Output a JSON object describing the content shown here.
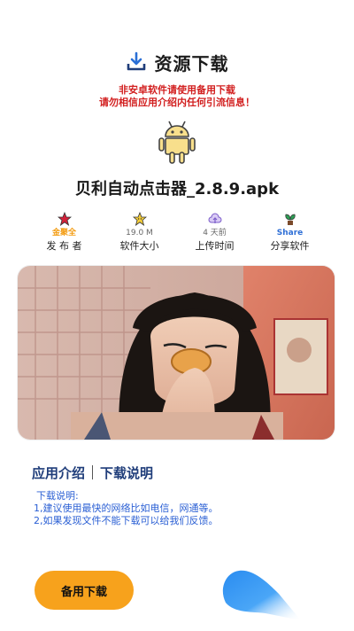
{
  "header": {
    "title": "资源下载",
    "icon": "download-icon"
  },
  "warning": {
    "line1": "非安卓软件请使用备用下载",
    "line2": "请勿相信应用介绍内任何引流信息！"
  },
  "app": {
    "name": "贝利自动点击器_2.8.9.apk",
    "icon": "android-icon"
  },
  "stats": [
    {
      "value": "金聚全",
      "label": "发 布 者",
      "icon": "star-badge-icon"
    },
    {
      "value": "19.0 M",
      "label": "软件大小",
      "icon": "smile-star-icon"
    },
    {
      "value": "4 天前",
      "label": "上传时间",
      "icon": "upload-cloud-icon"
    },
    {
      "value": "Share",
      "label": "分享软件",
      "icon": "share-plant-icon"
    }
  ],
  "tabs": {
    "intro": "应用介绍",
    "download": "下载说明"
  },
  "description": {
    "heading": "下载说明:",
    "line1": "1,建议使用最快的网络比如电信，网通等。",
    "line2": "2,如果发现文件不能下载可以给我们反馈。"
  },
  "buttons": {
    "backup_label": "备用下载"
  },
  "colors": {
    "accent_orange": "#f7a21c",
    "link_blue": "#2a5fd4",
    "warning_red": "#d21f1f",
    "tab_navy": "#1f3d7a"
  }
}
